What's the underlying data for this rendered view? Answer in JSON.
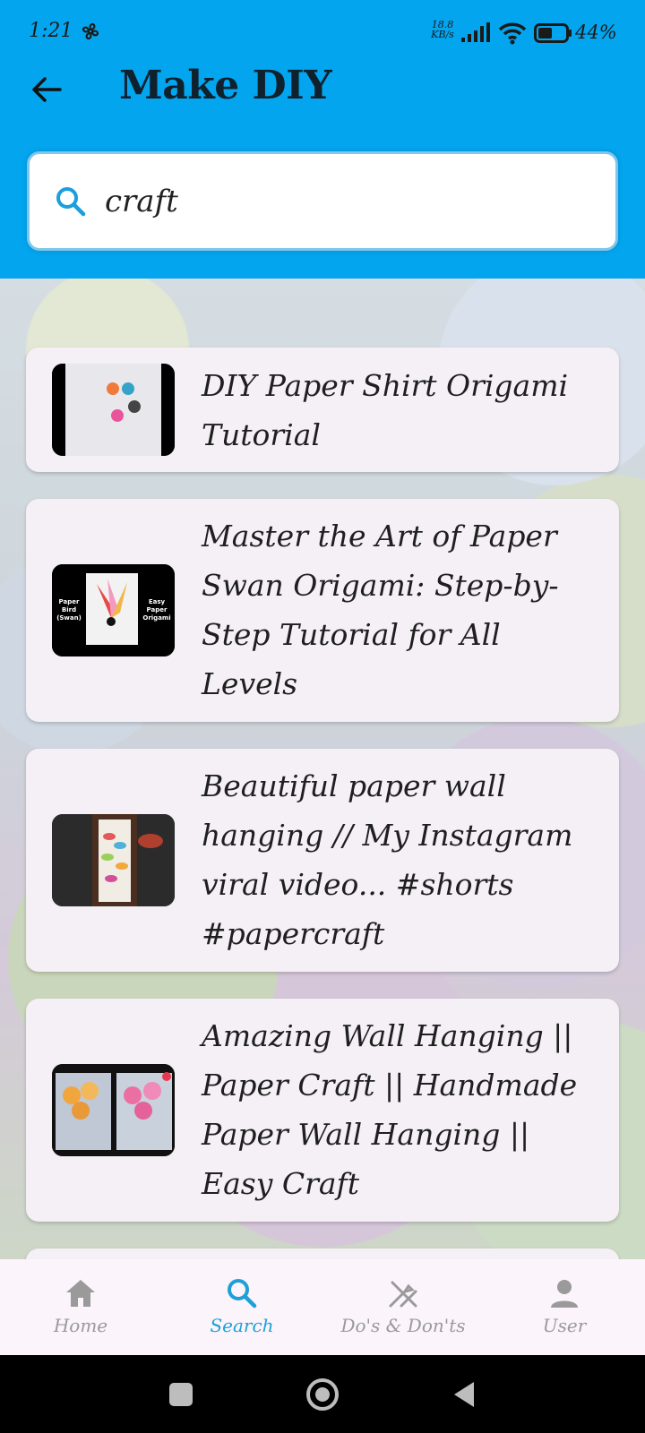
{
  "status_bar": {
    "time": "1:21",
    "net_speed_value": "18.8",
    "net_speed_unit": "KB/s",
    "battery_pct": "44%"
  },
  "header": {
    "title": "Make DIY",
    "back_icon": "arrow-left-icon"
  },
  "search": {
    "value": "craft",
    "placeholder": "",
    "icon": "search-icon"
  },
  "results": [
    {
      "title": "DIY Paper Shirt Origami Tutorial",
      "thumb_caption_left": "",
      "thumb_caption_right": ""
    },
    {
      "title": "Master the Art of Paper Swan Origami: Step-by-Step Tutorial for All Levels",
      "thumb_caption_left": "Paper Bird (Swan)",
      "thumb_caption_right": "Easy Paper Origami"
    },
    {
      "title": "Beautiful paper wall hanging // My Instagram viral video... #shorts #papercraft",
      "thumb_caption_left": "",
      "thumb_caption_right": ""
    },
    {
      "title": "Amazing Wall Hanging || Paper Craft || Handmade Paper Wall Hanging || Easy Craft",
      "thumb_caption_left": "",
      "thumb_caption_right": ""
    }
  ],
  "bottom_nav": {
    "items": [
      {
        "label": "Home",
        "icon": "home-icon",
        "active": false
      },
      {
        "label": "Search",
        "icon": "search-icon",
        "active": true
      },
      {
        "label": "Do's & Don'ts",
        "icon": "crossed-tools-icon",
        "active": false
      },
      {
        "label": "User",
        "icon": "person-icon",
        "active": false
      }
    ]
  },
  "colors": {
    "header_bg": "#03A5EE",
    "accent": "#1da0d8",
    "card_bg": "#f4f0f6",
    "nav_inactive": "#9a9a9a"
  }
}
